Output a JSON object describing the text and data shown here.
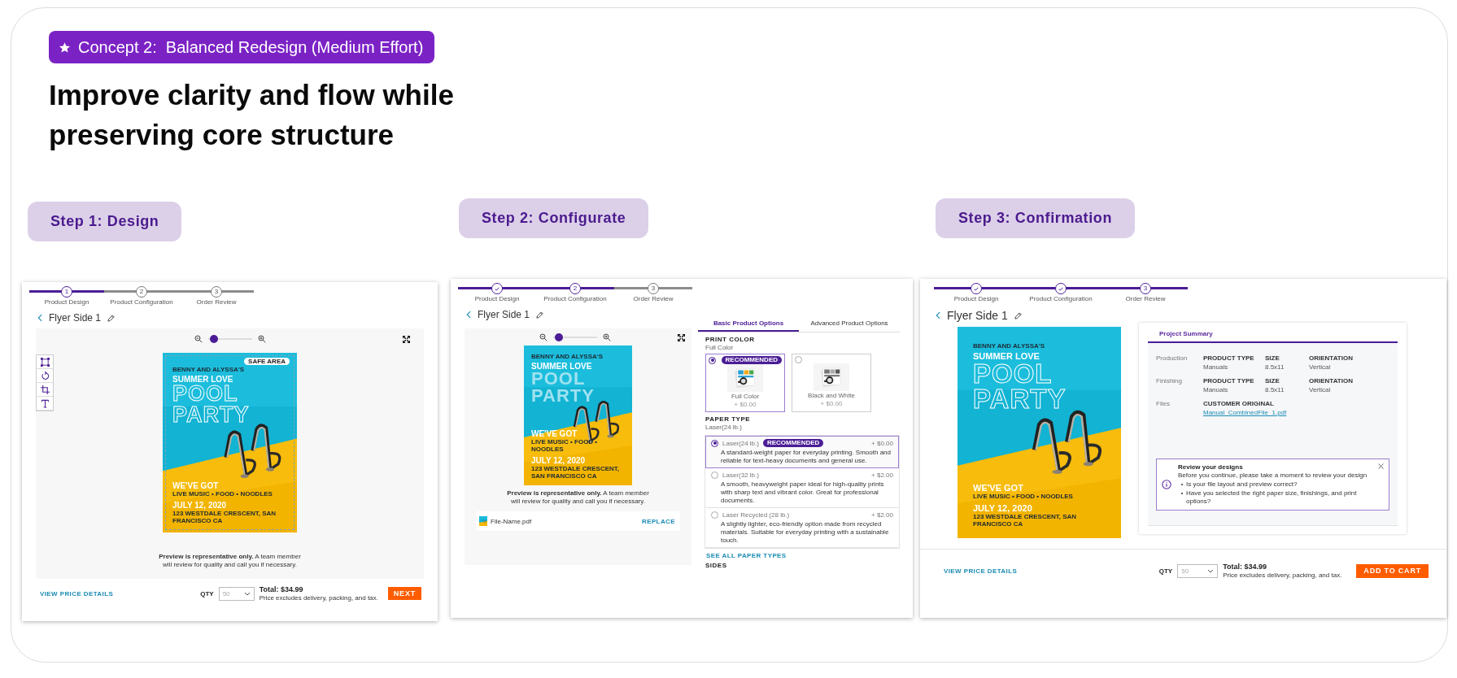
{
  "badge": {
    "label": "Concept 2:  Balanced Redesign (Medium Effort)"
  },
  "heading": "Improve clarity and flow while preserving core structure",
  "steps": [
    {
      "label": "Step 1: Design",
      "screen": {
        "kind": "design",
        "progress": [
          {
            "label": "Product Design",
            "number": "1",
            "done": false,
            "current": true
          },
          {
            "label": "Product Configuration",
            "number": "2",
            "done": false,
            "current": false
          },
          {
            "label": "Order Review",
            "number": "3",
            "done": false,
            "current": false
          }
        ],
        "title": "Flyer Side 1",
        "zoom": {
          "level": 0.05
        },
        "tools": [
          {
            "kind": "select"
          },
          {
            "kind": "rotate"
          },
          {
            "kind": "crop"
          },
          {
            "kind": "text"
          }
        ],
        "flyer": {
          "safe_area": "SAFE AREA",
          "kicker": "BENNY AND ALYSSA'S",
          "subtitle": "SUMMER LOVE",
          "title_lines": [
            "POOL",
            "PARTY"
          ],
          "tagline": "WE'VE GOT",
          "lineup": "LIVE MUSIC • FOOD • NOODLES",
          "date": "JULY 12, 2020",
          "address": "123 WESTDALE CRESCENT, SAN FRANCISCO CA"
        },
        "note": "**Preview is representative only.** A team member will review for quality and call you if necessary.",
        "footer": {
          "link": "VIEW PRICE DETAILS",
          "qty_label": "QTY",
          "qty": "50",
          "total": "Total: $34.99",
          "total_note": "Price excludes delivery, packing, and tax.",
          "button": "NEXT"
        }
      }
    },
    {
      "label": "Step 2: Configurate",
      "screen": {
        "kind": "configure",
        "progress": [
          {
            "label": "Product Design",
            "done": true
          },
          {
            "label": "Product Configuration",
            "number": "2",
            "done": false,
            "current": true
          },
          {
            "label": "Order Review",
            "number": "3",
            "done": false,
            "current": false
          }
        ],
        "title": "Flyer Side 1",
        "zoom": {
          "level": 0.05
        },
        "flyer": {
          "kicker": "BENNY AND ALYSSA'S",
          "subtitle": "SUMMER LOVE",
          "title_lines": [
            "POOL",
            "PARTY"
          ],
          "tagline": "WE'VE GOT",
          "lineup": "LIVE MUSIC • FOOD • NOODLES",
          "date": "JULY 12, 2020",
          "address": "123 WESTDALE CRESCENT, SAN FRANCISCO CA"
        },
        "note": "**Preview is representative only.** A team member will review for quality and call you if necessary.",
        "file": {
          "name": "File-Name.pdf",
          "action": "REPLACE"
        },
        "options": {
          "tabs": [
            {
              "label": "Basic Product Options",
              "selected": true
            },
            {
              "label": "Advanced Product Options",
              "selected": false
            }
          ],
          "print_color": {
            "heading": "PRINT COLOR",
            "value": "Full Color",
            "choices": [
              {
                "label": "Full Color",
                "price": "+ $0.00",
                "badge": "RECOMMENDED",
                "selected": true
              },
              {
                "label": "Black and White",
                "price": "+ $0.00",
                "selected": false
              }
            ]
          },
          "paper_type": {
            "heading": "PAPER TYPE",
            "value": "Laser(24 lb.)",
            "choices": [
              {
                "label": "Laser(24 lb.)",
                "badge": "RECOMMENDED",
                "price": "+ $0.00",
                "description": "A standard-weight paper for everyday printing. Smooth and reliable for text-heavy documents and general use.",
                "selected": true
              },
              {
                "label": "Laser(32 lb.)",
                "price": "+ $2.00",
                "description": "A smooth, heavyweight paper ideal for high-quality prints with sharp text and vibrant color. Great for professional documents.",
                "selected": false
              },
              {
                "label": "Laser Recycled (28 lb.)",
                "price": "+ $2.00",
                "description": "A slightly lighter, eco-friendly option made from recycled materials. Suitable for everyday printing with a sustainable touch.",
                "selected": false
              }
            ]
          },
          "link": "SEE ALL PAPER TYPES",
          "next_heading": "SIDES"
        }
      }
    },
    {
      "label": "Step 3: Confirmation",
      "screen": {
        "kind": "confirm",
        "progress": [
          {
            "label": "Product Design",
            "done": true
          },
          {
            "label": "Product Configuration",
            "done": true
          },
          {
            "label": "Order Review",
            "number": "3",
            "done": false,
            "current": true
          }
        ],
        "title": "Flyer Side 1",
        "flyer": {
          "kicker": "BENNY AND ALYSSA'S",
          "subtitle": "SUMMER LOVE",
          "title_lines": [
            "POOL",
            "PARTY"
          ],
          "tagline": "WE'VE GOT",
          "lineup": "LIVE MUSIC • FOOD • NOODLES",
          "date": "JULY 12, 2020",
          "address": "123 WESTDALE CRESCENT, SAN FRANCISCO CA"
        },
        "summary": {
          "tab": "Project Summary",
          "rows": [
            {
              "label": "Production",
              "fields": [
                {
                  "kind": "text",
                  "name": "PRODUCT TYPE",
                  "value": "Manuals"
                },
                {
                  "kind": "text",
                  "name": "SIZE",
                  "value": "8.5x11"
                },
                {
                  "kind": "text",
                  "name": "ORIENTATION",
                  "value": "Vertical"
                }
              ]
            },
            {
              "label": "Finishing",
              "fields": [
                {
                  "kind": "text",
                  "name": "PRODUCT TYPE",
                  "value": "Manuals"
                },
                {
                  "kind": "text",
                  "name": "SIZE",
                  "value": "8.5x11"
                },
                {
                  "kind": "text",
                  "name": "ORIENTATION",
                  "value": "Vertical"
                }
              ]
            },
            {
              "label": "Files",
              "fields": [
                {
                  "kind": "link",
                  "name": "CUSTOMER ORIGINAL",
                  "value": "Manual_CombinedFile_1.pdf"
                }
              ]
            }
          ],
          "alert": {
            "title": "Review your designs",
            "text": "Before you continue, please take a moment to review your design",
            "items": [
              "Is your file layout and preview correct?",
              "Have you selected the right paper size, finishings, and print options?"
            ]
          }
        },
        "footer": {
          "link": "VIEW PRICE DETAILS",
          "qty_label": "QTY",
          "qty": "50",
          "total": "Total: $34.99",
          "total_note": "Price excludes delivery, packing, and tax.",
          "button": "ADD TO CART"
        }
      }
    }
  ]
}
